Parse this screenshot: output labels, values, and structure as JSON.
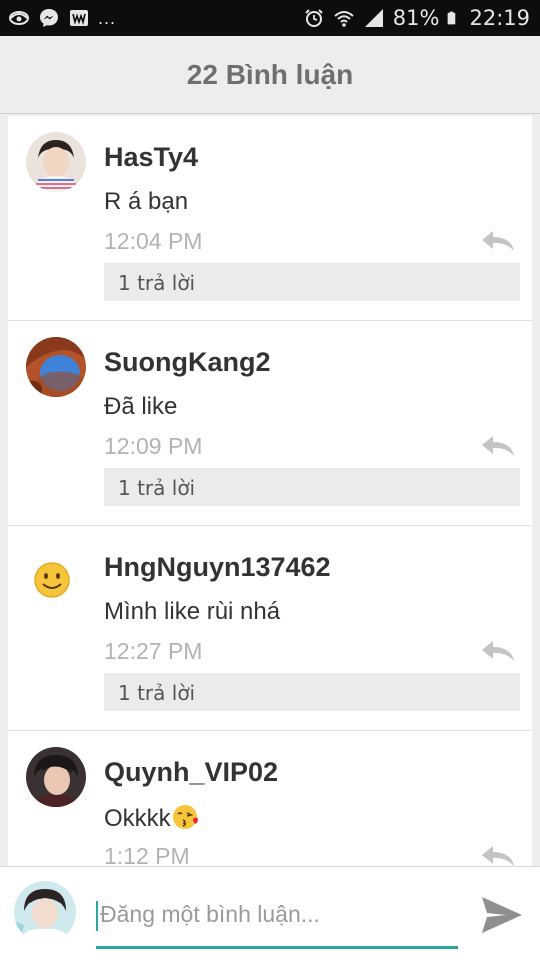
{
  "status_bar": {
    "more": "...",
    "battery": "81%",
    "time": "22:19",
    "icons": [
      "eye-icon",
      "messenger-icon",
      "w-app-icon",
      "alarm-icon",
      "wifi-icon",
      "signal-icon",
      "battery-icon"
    ]
  },
  "header": {
    "title": "22 Bình luận"
  },
  "comments": [
    {
      "username": "HasTy4",
      "message": "R á bạn",
      "time": "12:04 PM",
      "replies": "1 trả lời"
    },
    {
      "username": "SuongKang2",
      "message": "Đã like",
      "time": "12:09 PM",
      "replies": "1 trả lời"
    },
    {
      "username": "HngNguyn137462",
      "message": "Mình like rùi nhá",
      "time": "12:27 PM",
      "replies": "1 trả lời"
    },
    {
      "username": "Quynh_VIP02",
      "message": "Okkkk",
      "message_emoji": "kiss-emoji",
      "time": "1:12 PM"
    }
  ],
  "input": {
    "placeholder": "Đăng một bình luận..."
  },
  "colors": {
    "accent": "#2aa7a0",
    "header_bg": "#ededed",
    "status_bar_bg": "#0d0d0d"
  }
}
